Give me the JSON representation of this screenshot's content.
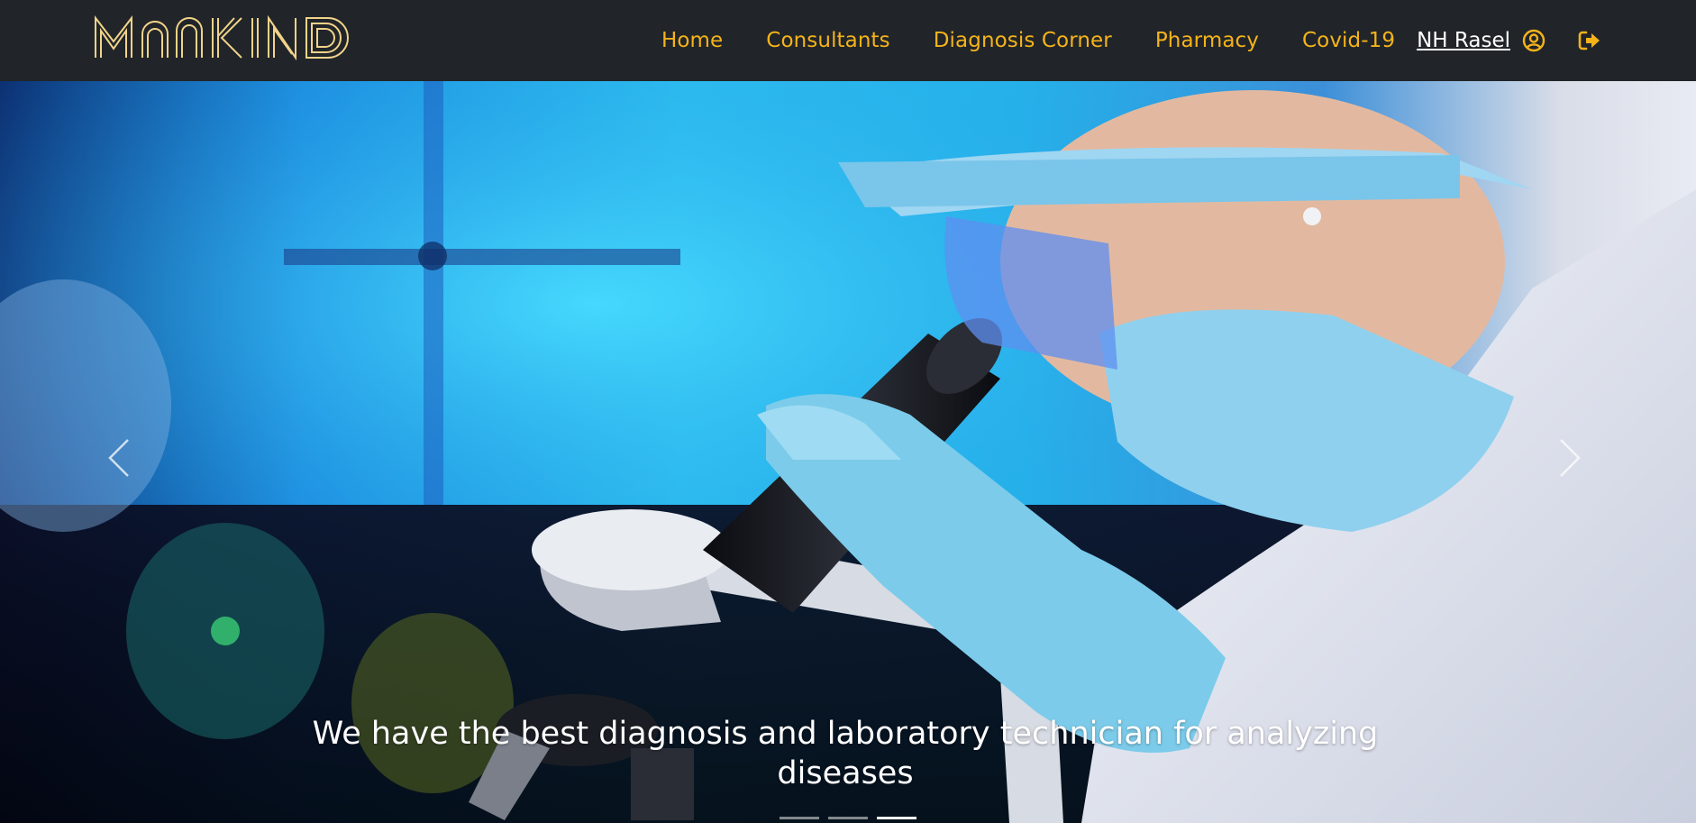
{
  "brand": {
    "name": "Mankind"
  },
  "nav": {
    "links": [
      "Home",
      "Consultants",
      "Diagnosis Corner",
      "Pharmacy",
      "Covid-19"
    ],
    "user_name": "NH Rasel",
    "user_icon": "user-circle-icon",
    "logout_icon": "sign-out-icon"
  },
  "carousel": {
    "caption": "We have the best diagnosis and laboratory technician for analyzing diseases",
    "slide_count": 3,
    "active_slide": 3,
    "prev_icon": "chevron-left-icon",
    "next_icon": "chevron-right-icon"
  },
  "colors": {
    "navbar_bg": "#212529",
    "nav_link": "#f5b31a",
    "user_name": "#ffffff"
  }
}
